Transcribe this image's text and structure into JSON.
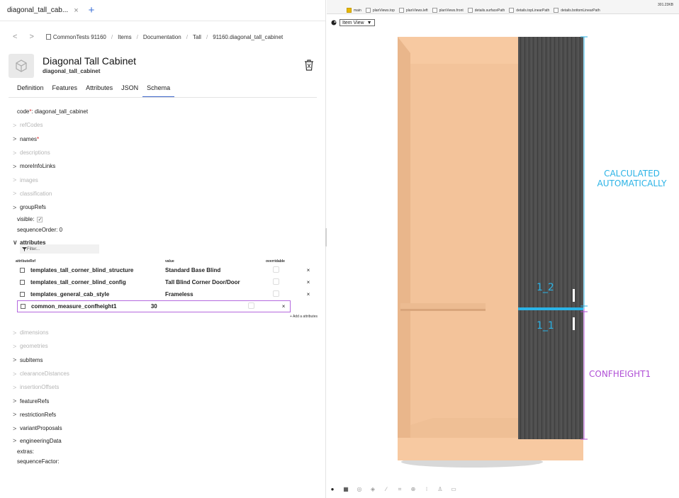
{
  "tab": {
    "label": "diagonal_tall_cab...",
    "close": "×",
    "add": "+"
  },
  "breadcrumb": {
    "back": "<",
    "forward": ">",
    "items": [
      "CommonTests 91160",
      "Items",
      "Documentation",
      "Tall",
      "91160.diagonal_tall_cabinet"
    ],
    "sep": "/"
  },
  "header": {
    "title": "Diagonal Tall Cabinet",
    "subtitle": "diagonal_tall_cabinet"
  },
  "subtabs": [
    "Definition",
    "Features",
    "Attributes",
    "JSON",
    "Schema"
  ],
  "schema": {
    "code_label": "code",
    "req": "*",
    "code_value": ": diagonal_tall_cabinet",
    "sections_top": [
      {
        "label": "refCodes",
        "muted": true
      },
      {
        "label": "names",
        "muted": false,
        "required": true
      },
      {
        "label": "descriptions",
        "muted": true
      },
      {
        "label": "moreInfoLinks",
        "muted": false
      },
      {
        "label": "images",
        "muted": true
      },
      {
        "label": "classification",
        "muted": true
      },
      {
        "label": "groupRefs",
        "muted": false
      }
    ],
    "visible_label": "visible:",
    "visible_check": "✓",
    "sequence_order_label": "sequenceOrder:",
    "sequence_order_value": "0",
    "attributes_label": "attributes",
    "chev_closed": ">",
    "chev_open": "∨",
    "filter_placeholder": "Filter...",
    "columns": [
      "attributeRef",
      "value",
      "overridable"
    ],
    "rows": [
      {
        "ref": "templates_tall_corner_blind_structure",
        "value": "Standard Base Blind"
      },
      {
        "ref": "templates_tall_corner_blind_config",
        "value": "Tall Blind Corner Door/Door"
      },
      {
        "ref": "templates_general_cab_style",
        "value": "Frameless"
      },
      {
        "ref": "common_measure_confheight1",
        "value": "30"
      }
    ],
    "remove": "×",
    "add_attribute": "+ Add a attributes",
    "sections_bottom": [
      {
        "label": "dimensions",
        "muted": true
      },
      {
        "label": "geometries",
        "muted": true
      },
      {
        "label": "subItems",
        "muted": false
      },
      {
        "label": "clearanceDistances",
        "muted": true
      },
      {
        "label": "insertionOffsets",
        "muted": true
      },
      {
        "label": "featureRefs",
        "muted": false
      },
      {
        "label": "restrictionRefs",
        "muted": false
      },
      {
        "label": "variantProposals",
        "muted": false
      },
      {
        "label": "engineeringData",
        "muted": false
      }
    ],
    "extras_label": "extras:",
    "sequence_factor_label": "sequenceFactor:"
  },
  "viewer": {
    "filesize": "301.23KB",
    "checkboxes": [
      {
        "label": "main",
        "checked": true
      },
      {
        "label": "planViews.top",
        "checked": false
      },
      {
        "label": "planViews.left",
        "checked": false
      },
      {
        "label": "planViews.front",
        "checked": false
      },
      {
        "label": "details.surfacePath",
        "checked": false
      },
      {
        "label": "details.topLinearPath",
        "checked": false
      },
      {
        "label": "details.bottomLinearPath",
        "checked": false
      }
    ],
    "view_select": "Item View",
    "view_select_caret": "▼",
    "callouts": {
      "calc_line1": "CALCULATED",
      "calc_line2": "AUTOMATICALLY",
      "label_1_2": "1_2",
      "label_1_1": "1_1",
      "confheight": "CONFHEIGHT1"
    },
    "toolbar_icons": [
      "palette-icon",
      "grid-icon",
      "circle-icon",
      "cube-icon",
      "pencil-icon",
      "frame-icon",
      "target-icon",
      "dots-icon",
      "person-icon",
      "image-icon"
    ],
    "colors": {
      "cabinet": "#f7c9a1",
      "panel": "#4a4a4a",
      "cyan": "#2bb3e6",
      "purple": "#b04fd6"
    }
  }
}
